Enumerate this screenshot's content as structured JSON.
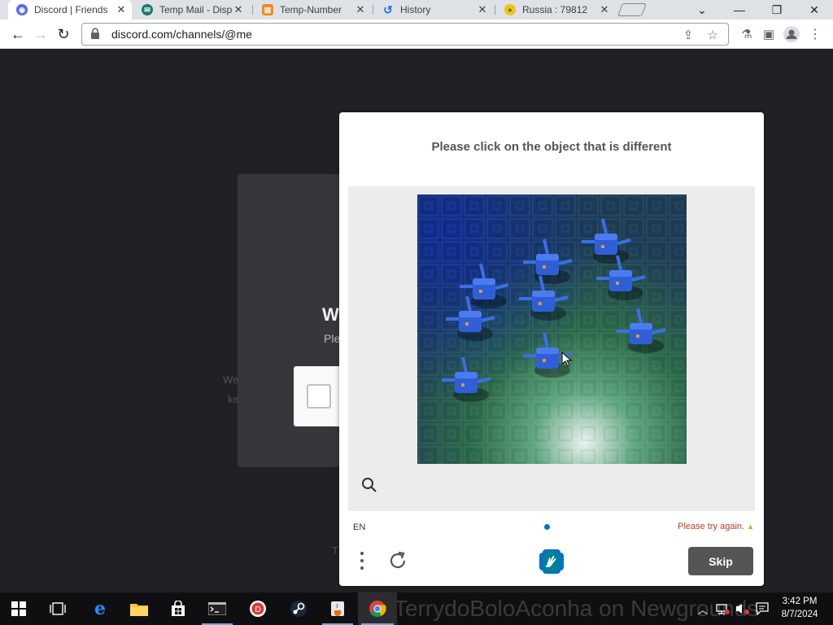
{
  "browser": {
    "tabs": [
      {
        "title": "Discord | Friends",
        "favicon": "discord-icon",
        "active": true
      },
      {
        "title": "Temp Mail - Disposable",
        "favicon": "temp-mail-icon",
        "active": false
      },
      {
        "title": "Temp-Number",
        "favicon": "temp-number-icon",
        "active": false
      },
      {
        "title": "History",
        "favicon": "history-icon",
        "active": false
      },
      {
        "title": "Russia : 79812",
        "favicon": "russia-site-icon",
        "active": false
      }
    ],
    "url": "discord.com/channels/@me"
  },
  "discord": {
    "title": "W",
    "subtitle": "Ple",
    "side_text_1": "We",
    "side_text_2": "ke",
    "footer_text": "T"
  },
  "captcha": {
    "prompt": "Please click on the object that is different",
    "language": "EN",
    "error": "Please try again.",
    "skip_label": "Skip"
  },
  "taskbar": {
    "apps": [
      "start-icon",
      "task-view-icon",
      "edge-icon",
      "file-explorer-icon",
      "store-icon",
      "terminal-icon",
      "red-app-icon",
      "steam-icon",
      "java-icon",
      "chrome-icon"
    ],
    "watermark": "TerrydoBoloAconha on Newgrounds",
    "time": "3:42 PM",
    "date": "8/7/2024"
  }
}
